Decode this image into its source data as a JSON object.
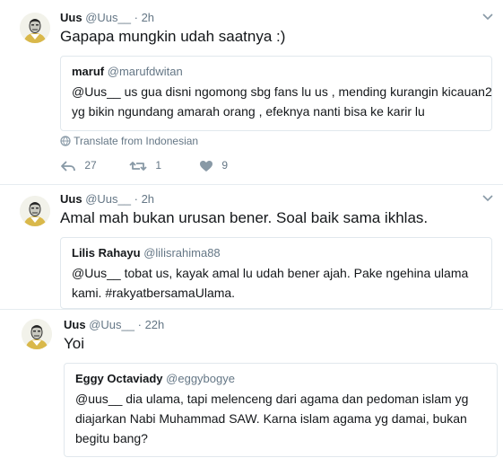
{
  "tweets": [
    {
      "name": "Uus",
      "handle": "@Uus__",
      "sep": "·",
      "time": "2h",
      "text": "Gapapa mungkin udah saatnya :)",
      "quote": {
        "name": "maruf",
        "handle": "@marufdwitan",
        "line1": "@Uus__ us gua disni ngomong sbg fans lu us , mending kurangin kicauan2",
        "line2": "yg bikin ngundang amarah orang , efeknya nanti bisa ke karir lu"
      },
      "translate": "Translate from Indonesian",
      "actions": {
        "reply_count": "27",
        "retweet_count": "1",
        "like_count": "9"
      }
    },
    {
      "name": "Uus",
      "handle": "@Uus__",
      "sep": "·",
      "time": "2h",
      "text": "Amal mah bukan urusan bener. Soal baik sama ikhlas.",
      "quote": {
        "name": "Lilis Rahayu",
        "handle": "@lilisrahima88",
        "line1": "@Uus__ tobat us, kayak amal lu udah bener ajah. Pake ngehina ulama",
        "line2": "kami. #rakyatbersamaUlama."
      }
    },
    {
      "name": "Uus",
      "handle": "@Uus__",
      "sep": "·",
      "time": "22h",
      "text": "Yoi",
      "quote": {
        "name": "Eggy Octaviady",
        "handle": "@eggybogye",
        "line1": "@uus__ dia ulama, tapi melenceng dari agama dan pedoman islam yg",
        "line2": "diajarkan Nabi Muhammad SAW. Karna islam agama yg damai, bukan",
        "line3": "begitu bang?"
      }
    }
  ],
  "colors": {
    "text": "#14171a",
    "secondary": "#657786",
    "border": "#e1e8ed"
  },
  "icons": [
    "avatar",
    "chevron-down-icon",
    "globe-icon",
    "reply-icon",
    "retweet-icon",
    "like-icon"
  ]
}
